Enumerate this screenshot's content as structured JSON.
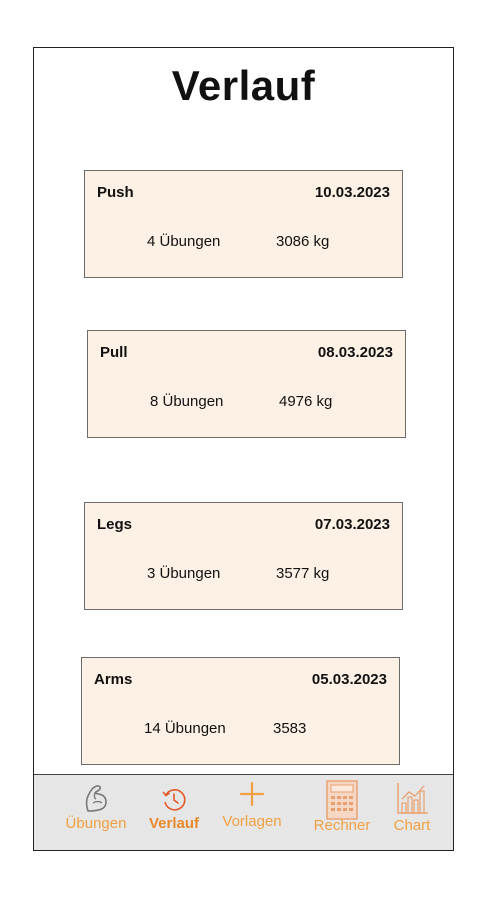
{
  "header": {
    "title": "Verlauf"
  },
  "workouts": [
    {
      "name": "Push",
      "date": "10.03.2023",
      "count": "4 Übungen",
      "weight": "3086 kg"
    },
    {
      "name": "Pull",
      "date": "08.03.2023",
      "count": "8 Übungen",
      "weight": "4976 kg"
    },
    {
      "name": "Legs",
      "date": "07.03.2023",
      "count": "3 Übungen",
      "weight": "3577 kg"
    },
    {
      "name": "Arms",
      "date": "05.03.2023",
      "count": "14 Übungen",
      "weight": "3583"
    }
  ],
  "tabbar": {
    "items": [
      {
        "label": "Übungen",
        "icon": "flexed-arm-icon",
        "active": false
      },
      {
        "label": "Verlauf",
        "icon": "clock-history-icon",
        "active": true
      },
      {
        "label": "Vorlagen",
        "icon": "plus-icon",
        "active": false
      },
      {
        "label": "Rechner",
        "icon": "calculator-icon",
        "active": false
      },
      {
        "label": "Chart",
        "icon": "bar-chart-icon",
        "active": false
      }
    ]
  },
  "colors": {
    "accent": "#f0a040",
    "card_background": "#fdf1e6",
    "tabbar_background": "#e6e6e6"
  }
}
